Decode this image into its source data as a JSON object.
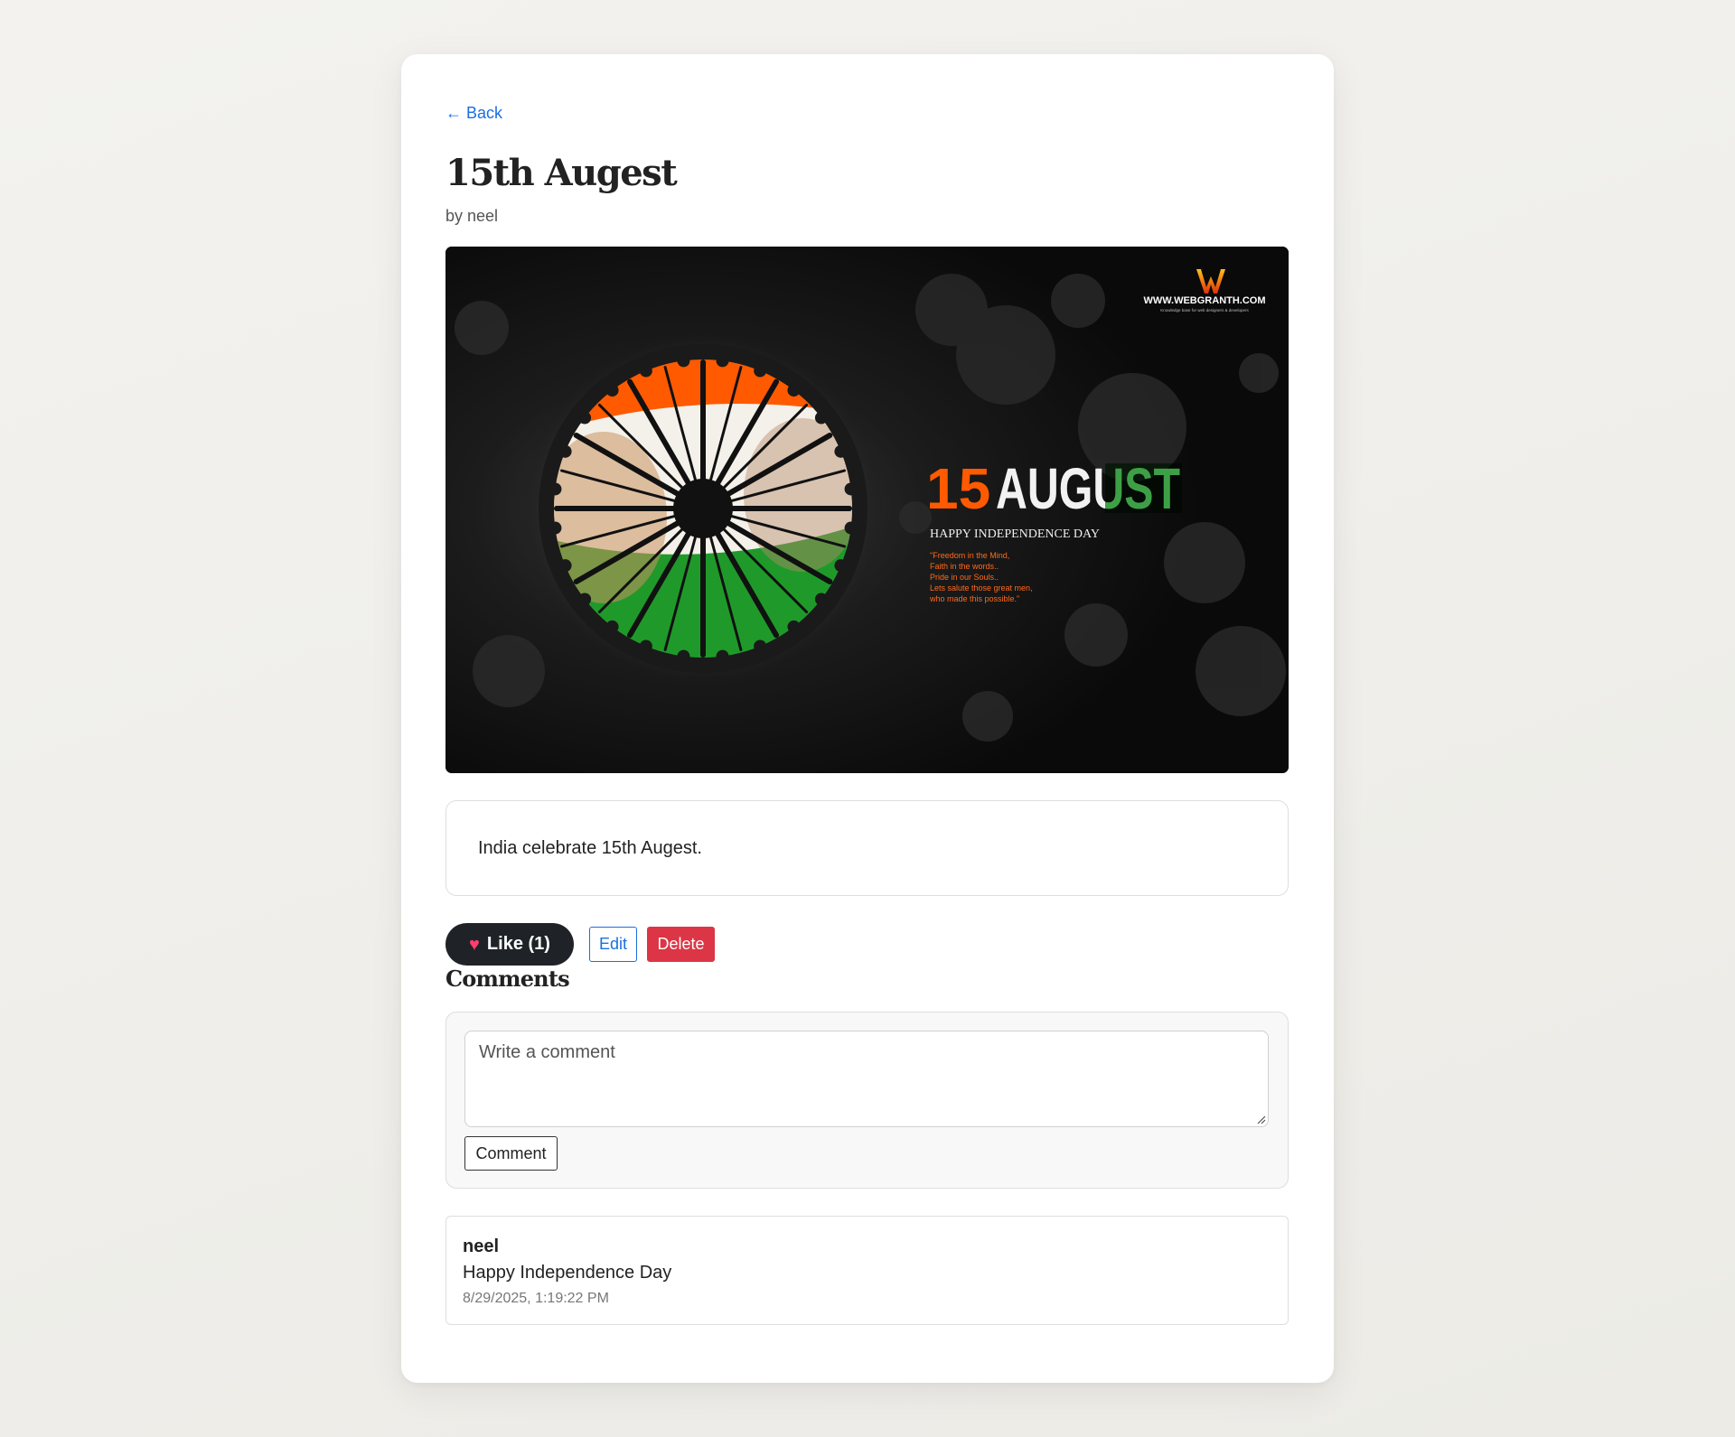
{
  "nav": {
    "back_label": "← Back"
  },
  "post": {
    "title": "15th Augest",
    "byline": "by neel",
    "body": "India celebrate 15th Augest.",
    "image": {
      "site_text": "WWW.WEBGRANTH.COM",
      "site_tagline": "Knowledge base for web designers & developers",
      "headline_num": "15",
      "headline_word": "AUGUST",
      "subheadline": "HAPPY INDEPENDENCE DAY",
      "quote_lines": [
        "\"Freedom in the Mind,",
        "Faith in the words..",
        "Pride in our Souls..",
        "Lets salute those great men,",
        "who made this possible.\""
      ]
    }
  },
  "actions": {
    "like_icon": "heart-icon",
    "like_label": "Like (1)",
    "edit_label": "Edit",
    "delete_label": "Delete"
  },
  "comments": {
    "heading": "Comments",
    "input_placeholder": "Write a comment",
    "submit_label": "Comment",
    "items": [
      {
        "author": "neel",
        "text": "Happy Independence Day",
        "time": "8/29/2025, 1:19:22 PM"
      }
    ]
  },
  "colors": {
    "link": "#1a6fe0",
    "like_bg": "#1f2328",
    "heart": "#ff3e6c",
    "delete": "#dc3545",
    "saffron": "#ff5a00",
    "green": "#1f9a2a"
  }
}
